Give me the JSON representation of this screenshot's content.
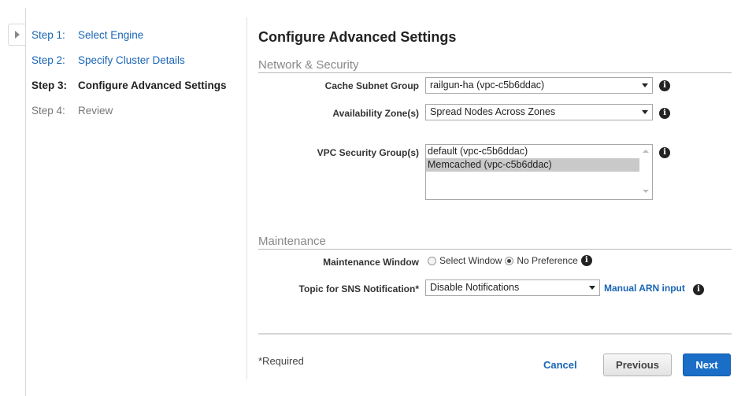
{
  "wizard": {
    "steps": [
      {
        "num": "Step 1:",
        "label": "Select Engine",
        "state": "link"
      },
      {
        "num": "Step 2:",
        "label": "Specify Cluster Details",
        "state": "link"
      },
      {
        "num": "Step 3:",
        "label": "Configure Advanced Settings",
        "state": "active"
      },
      {
        "num": "Step 4:",
        "label": "Review",
        "state": "pending"
      }
    ]
  },
  "main": {
    "title": "Configure Advanced Settings",
    "network": {
      "section_title": "Network & Security",
      "cache_subnet_group": {
        "label": "Cache Subnet Group",
        "value": "railgun-ha (vpc-c5b6ddac)"
      },
      "availability_zones": {
        "label": "Availability Zone(s)",
        "value": "Spread Nodes Across Zones"
      },
      "vpc_security_groups": {
        "label": "VPC Security Group(s)",
        "options": [
          {
            "text": "default (vpc-c5b6ddac)",
            "selected": false
          },
          {
            "text": "Memcached (vpc-c5b6ddac)",
            "selected": true
          }
        ]
      }
    },
    "maintenance": {
      "section_title": "Maintenance",
      "window": {
        "label": "Maintenance Window",
        "option_select": "Select Window",
        "option_no_pref": "No Preference",
        "selected": "No Preference"
      },
      "sns": {
        "label": "Topic for SNS Notification*",
        "value": "Disable Notifications",
        "manual_link": "Manual ARN input"
      }
    }
  },
  "footer": {
    "required_note": "*Required",
    "cancel": "Cancel",
    "previous": "Previous",
    "next": "Next"
  },
  "icons": {
    "info": "info-icon",
    "collapse": "expand-panel-icon"
  },
  "colors": {
    "link": "#1a65b5",
    "primary_button": "#1a6ec7"
  }
}
